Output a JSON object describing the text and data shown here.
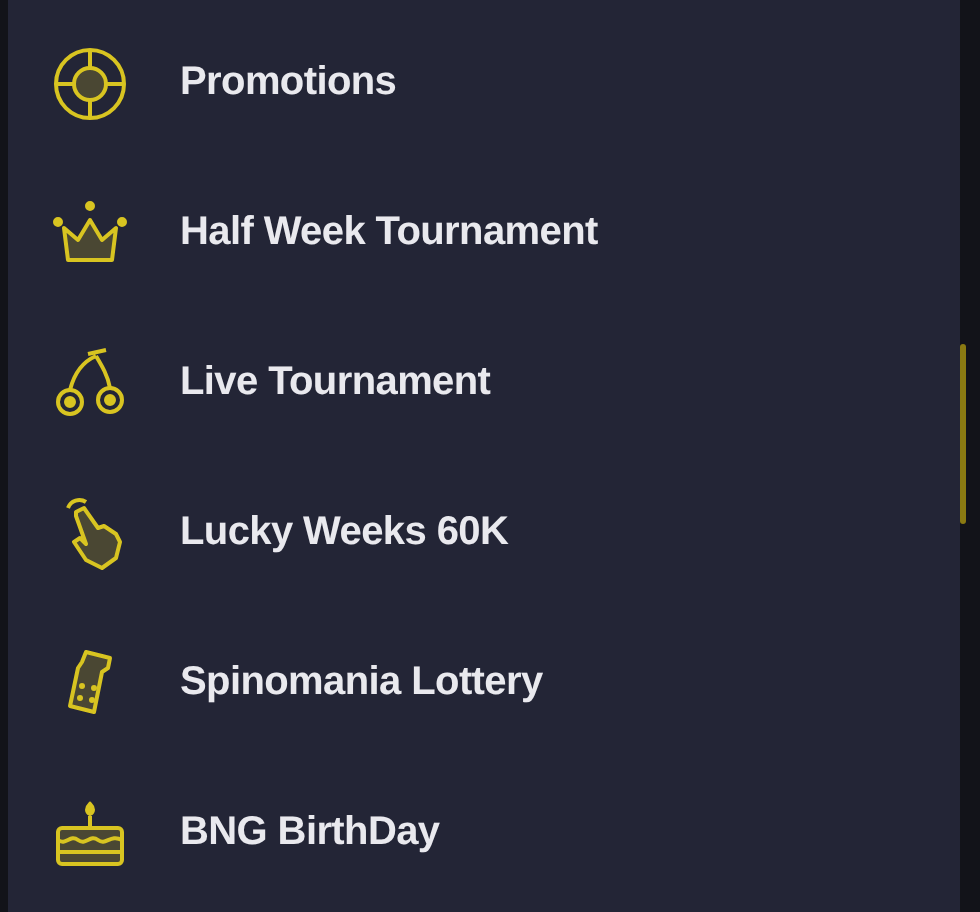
{
  "menu": {
    "items": [
      {
        "label": "Promotions"
      },
      {
        "label": "Half Week Tournament"
      },
      {
        "label": "Live Tournament"
      },
      {
        "label": "Lucky Weeks 60K"
      },
      {
        "label": "Spinomania Lottery"
      },
      {
        "label": "BNG BirthDay"
      }
    ]
  }
}
